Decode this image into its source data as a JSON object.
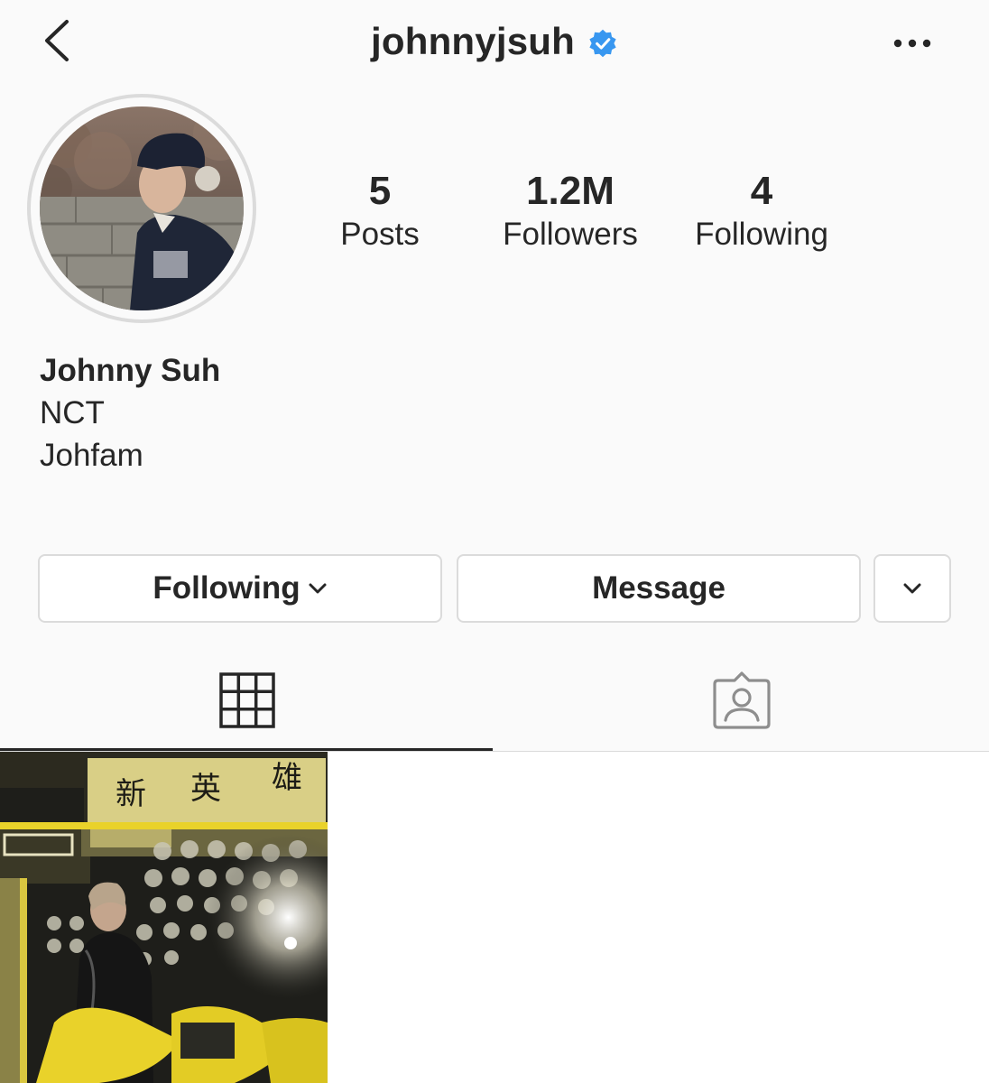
{
  "header": {
    "username": "johnnyjsuh",
    "verified": true,
    "icons": {
      "back": "chevron-left-icon",
      "verified": "verified-badge-icon",
      "more": "more-horizontal-icon"
    }
  },
  "profile": {
    "stats": {
      "posts_count": "5",
      "posts_label": "Posts",
      "followers_count": "1.2M",
      "followers_label": "Followers",
      "following_count": "4",
      "following_label": "Following"
    },
    "bio": {
      "name": "Johnny Suh",
      "line1": "NCT",
      "line2": "Johfam"
    }
  },
  "actions": {
    "following_label": "Following",
    "message_label": "Message",
    "icons": {
      "following_chevron": "chevron-down-icon",
      "dropdown": "chevron-down-icon"
    }
  },
  "tabs": {
    "active": "grid",
    "icons": {
      "grid": "grid-icon",
      "tagged": "tagged-person-icon"
    }
  },
  "colors": {
    "background": "#fafafa",
    "text": "#262626",
    "border": "#dbdbdb",
    "verified": "#3897f0",
    "post_accent": "#e9d22a"
  }
}
